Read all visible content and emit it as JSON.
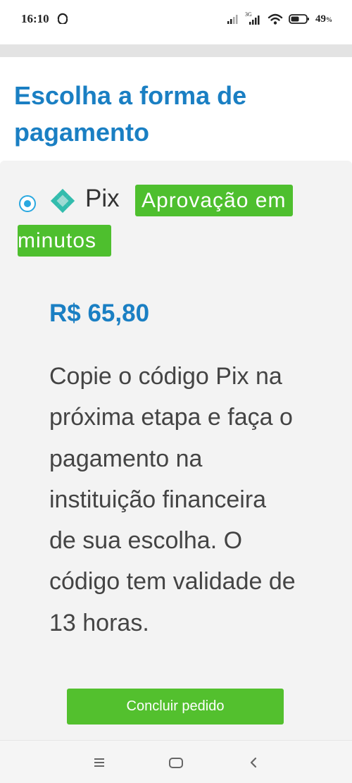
{
  "status_bar": {
    "time": "16:10",
    "battery_percent": "49",
    "battery_unit": "%",
    "network_type": "3G"
  },
  "header": {
    "title": "Escolha a forma de pagamento"
  },
  "payment_option": {
    "selected": true,
    "method_label": "Pix",
    "badge_line1": "Aprovação em",
    "badge_line2": "minutos",
    "price": "R$ 65,80",
    "description": "Copie o código Pix na próxima etapa e faça o pagamento na instituição financeira de sua escolha. O código tem validade de 13 horas."
  },
  "actions": {
    "submit_label": "Concluir pedido"
  },
  "colors": {
    "accent_blue": "#1a7fc3",
    "radio_blue": "#29a8e0",
    "success_green": "#53c02e",
    "pix_teal": "#32bcad"
  },
  "icons": {
    "sync": "sync-icon",
    "signal": "signal-icon",
    "wifi": "wifi-icon",
    "battery": "battery-icon",
    "pix": "pix-logo-icon",
    "menu": "menu-icon",
    "home": "home-icon",
    "back": "back-icon"
  }
}
